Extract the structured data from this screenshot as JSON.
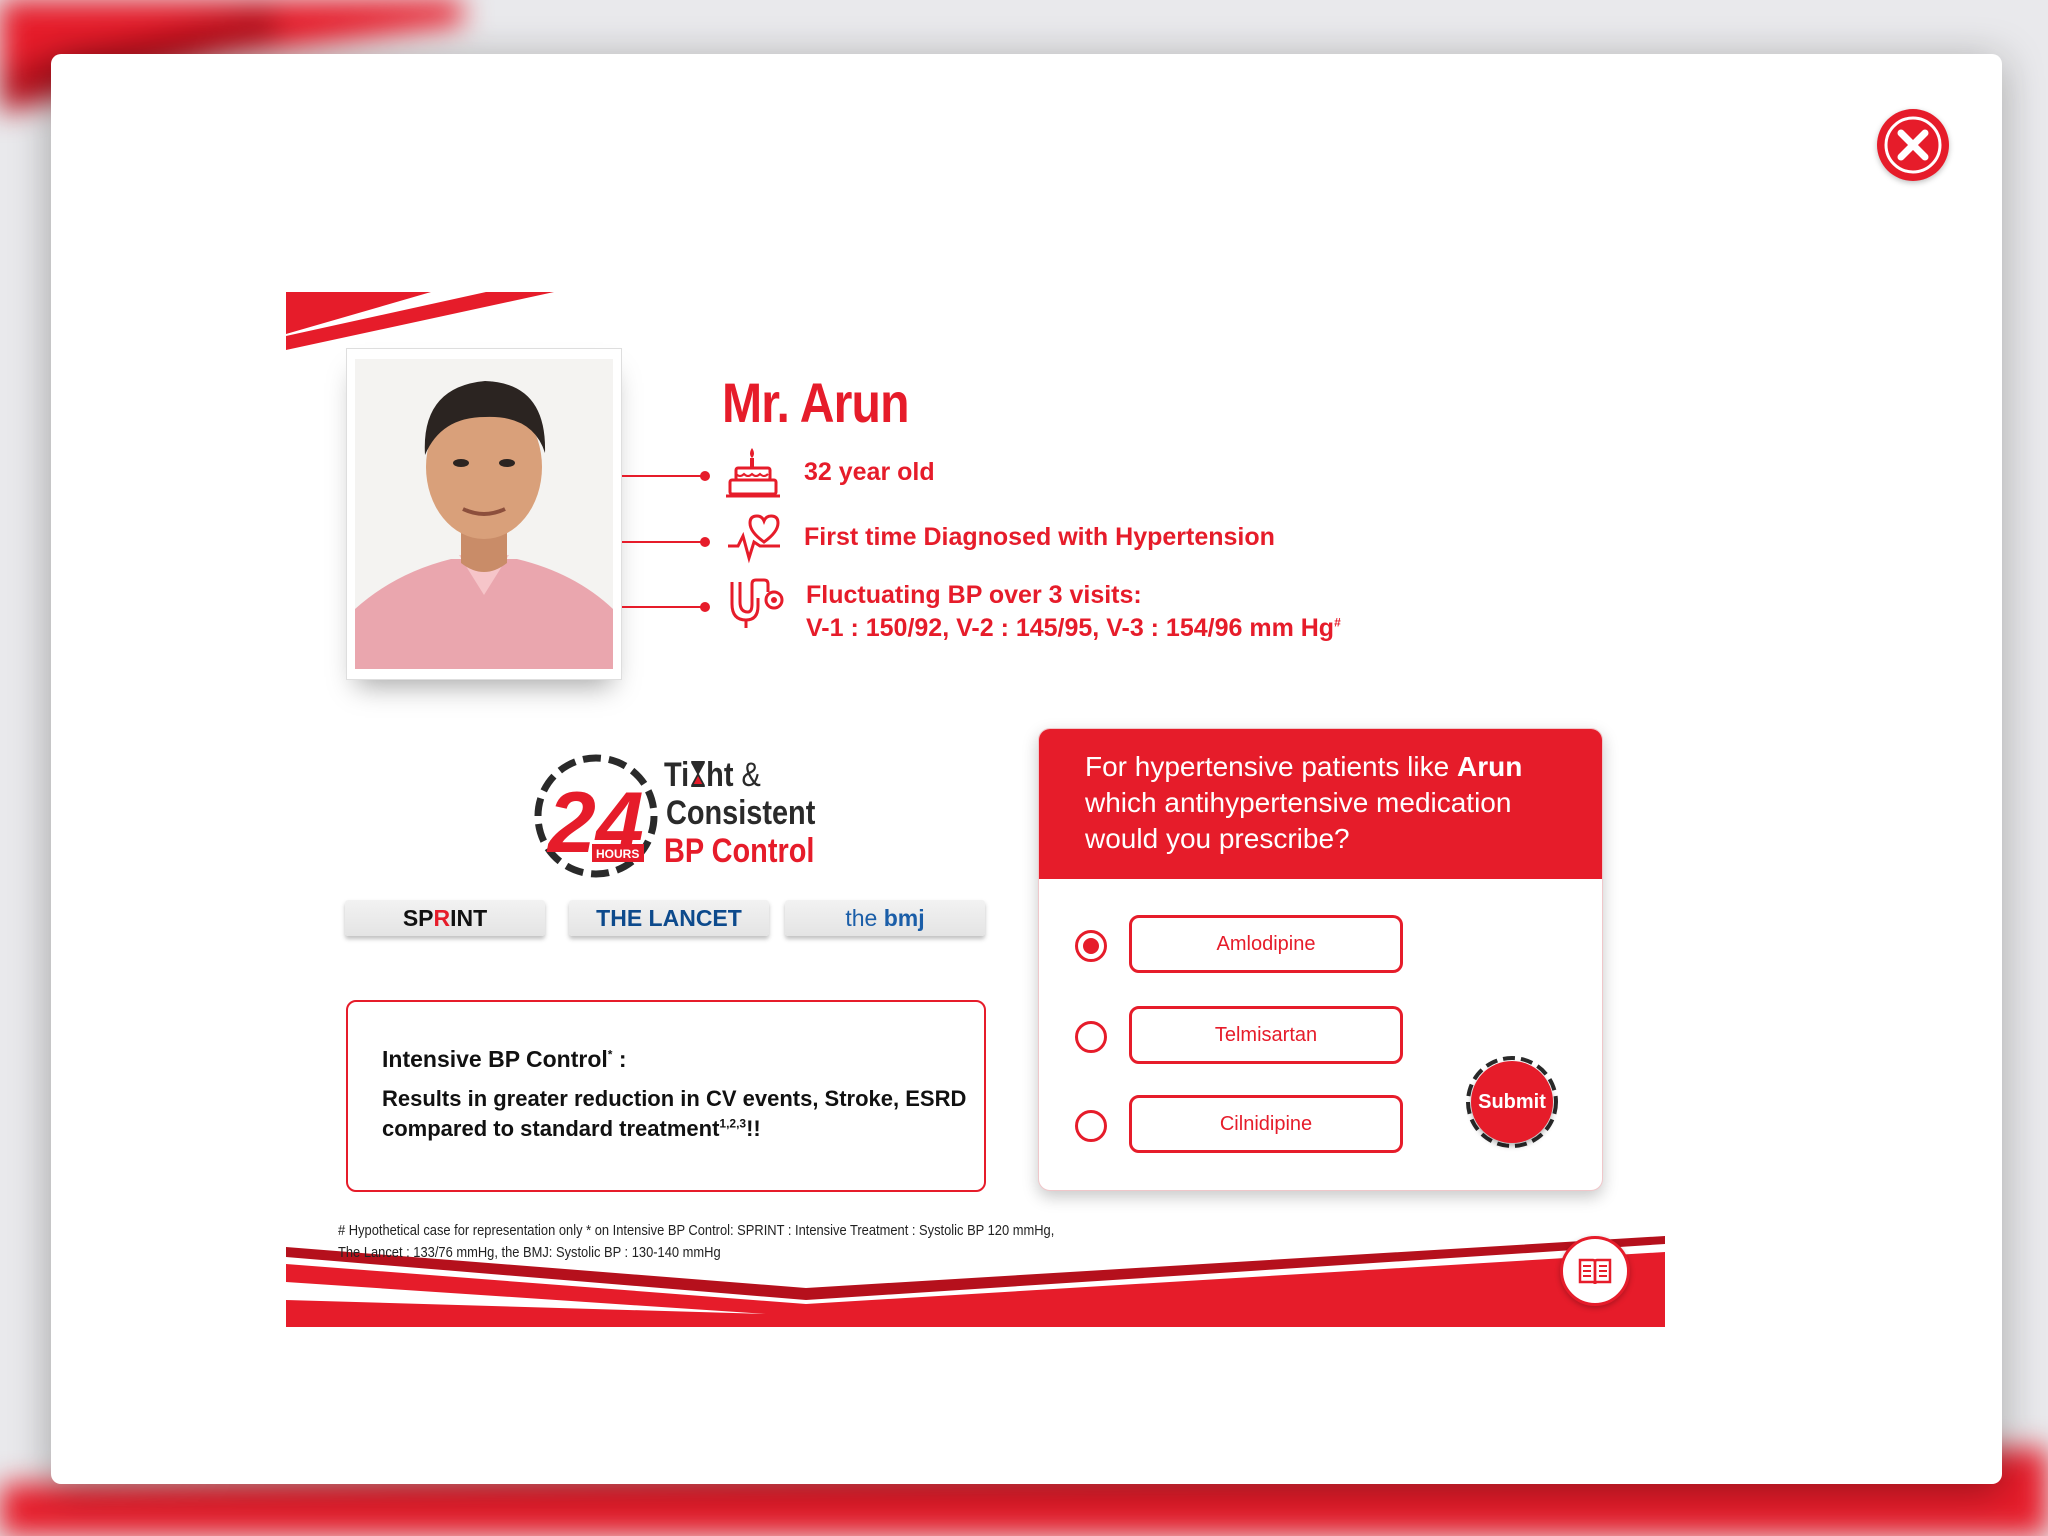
{
  "patient": {
    "name": "Mr. Arun",
    "age": "32 year old",
    "diagnosis": "First time Diagnosed with Hypertension",
    "bp_line1": "Fluctuating BP over 3 visits:",
    "bp_line2": "V-1 : 150/92, V-2 : 145/95, V-3 : 154/96 mm Hg",
    "bp_mark": "#"
  },
  "logo": {
    "number": "24",
    "hours": "HOURS",
    "line1_a": "Ti",
    "line1_b": "ht",
    "line1_amp": "&",
    "line2": "Consistent",
    "line3": "BP Control"
  },
  "journals": {
    "sprint_a": "SP",
    "sprint_r": "R",
    "sprint_b": "INT",
    "lancet": "THE LANCET",
    "bmj_a": "the ",
    "bmj_b": "bmj"
  },
  "info_box": {
    "title": "Intensive BP Control",
    "title_mark": "*",
    "title_colon": " :",
    "body": "Results in greater reduction in CV events, Stroke, ESRD compared to standard treatment",
    "body_refs": "1,2,3",
    "body_end": "!!"
  },
  "question": {
    "text_a": "For hypertensive patients like ",
    "text_name": "Arun",
    "text_b": " which antihypertensive medication would you prescribe?",
    "options": [
      {
        "label": "Amlodipine",
        "selected": true
      },
      {
        "label": "Telmisartan",
        "selected": false
      },
      {
        "label": "Cilnidipine",
        "selected": false
      }
    ],
    "submit_label": "Submit"
  },
  "footnote": {
    "line1": "# Hypothetical case for representation only * on Intensive BP Control: SPRINT : Intensive Treatment : Systolic BP 120 mmHg,",
    "line2": "The Lancet : 133/76 mmHg, the BMJ: Systolic BP : 130-140 mmHg"
  },
  "colors": {
    "accent": "#e61c2a",
    "accent_dark": "#b5101c",
    "lancet_blue": "#0d4a8c"
  },
  "icons": {
    "close": "close-icon",
    "age": "birthday-cake-icon",
    "diagnosis": "heart-pulse-icon",
    "bp": "stethoscope-icon",
    "references": "book-icon"
  }
}
